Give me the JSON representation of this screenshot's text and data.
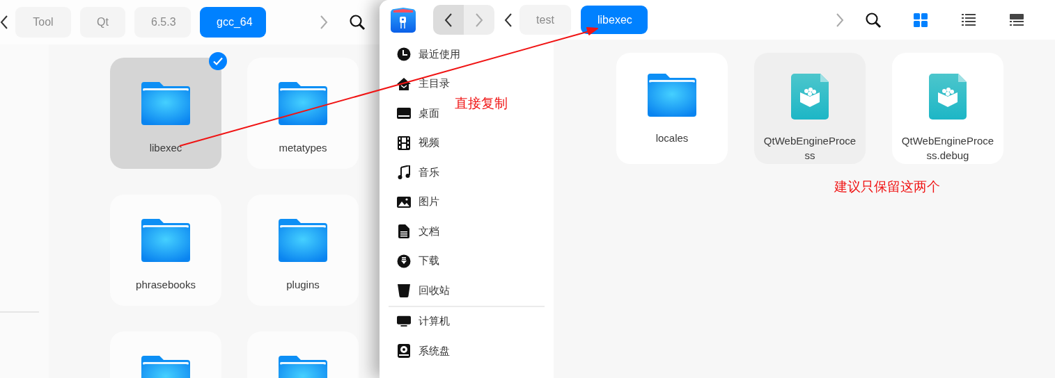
{
  "back_window": {
    "nav": {
      "back_disabled": false,
      "forward_disabled": true
    },
    "breadcrumbs": [
      {
        "label": "Tool",
        "selected": false
      },
      {
        "label": "Qt",
        "selected": false
      },
      {
        "label": "6.5.3",
        "selected": false
      },
      {
        "label": "gcc_64",
        "selected": true
      }
    ],
    "items": [
      {
        "kind": "folder",
        "name": "libexec",
        "selected": true
      },
      {
        "kind": "folder",
        "name": "metatypes",
        "selected": false
      },
      {
        "kind": "folder",
        "name": "phrasebooks",
        "selected": false
      },
      {
        "kind": "folder",
        "name": "plugins",
        "selected": false
      },
      {
        "kind": "folder",
        "selected": false
      },
      {
        "kind": "folder",
        "selected": false
      }
    ]
  },
  "front_window": {
    "nav": {
      "back_disabled": false,
      "forward_disabled": true
    },
    "breadcrumbs": [
      {
        "label": "test",
        "selected": false
      },
      {
        "label": "libexec",
        "selected": true
      }
    ],
    "view_modes": [
      {
        "kind": "icons",
        "selected": true
      },
      {
        "kind": "list",
        "selected": false
      },
      {
        "kind": "tree",
        "selected": false
      }
    ],
    "sidebar": [
      {
        "kind": "recent",
        "label": "最近使用"
      },
      {
        "kind": "home",
        "label": "主目录"
      },
      {
        "kind": "desktop",
        "label": "桌面"
      },
      {
        "kind": "videos",
        "label": "视频"
      },
      {
        "kind": "music",
        "label": "音乐"
      },
      {
        "kind": "pictures",
        "label": "图片"
      },
      {
        "kind": "documents",
        "label": "文档"
      },
      {
        "kind": "downloads",
        "label": "下载"
      },
      {
        "kind": "trash",
        "label": "回收站"
      },
      {
        "kind": "divider"
      },
      {
        "kind": "computer",
        "label": "计算机"
      },
      {
        "kind": "disk",
        "label": "系统盘"
      }
    ],
    "items": [
      {
        "kind": "folder",
        "name": "locales",
        "highlighted": false
      },
      {
        "kind": "executable",
        "name": "QtWebEngineProcess",
        "highlighted": true
      },
      {
        "kind": "executable",
        "name": "QtWebEngineProcess.debug",
        "highlighted": false
      }
    ]
  },
  "annotations": [
    {
      "kind": "arrow"
    },
    {
      "kind": "note",
      "text": "直接复制"
    },
    {
      "kind": "note",
      "text": "建议只保留这两个"
    }
  ]
}
